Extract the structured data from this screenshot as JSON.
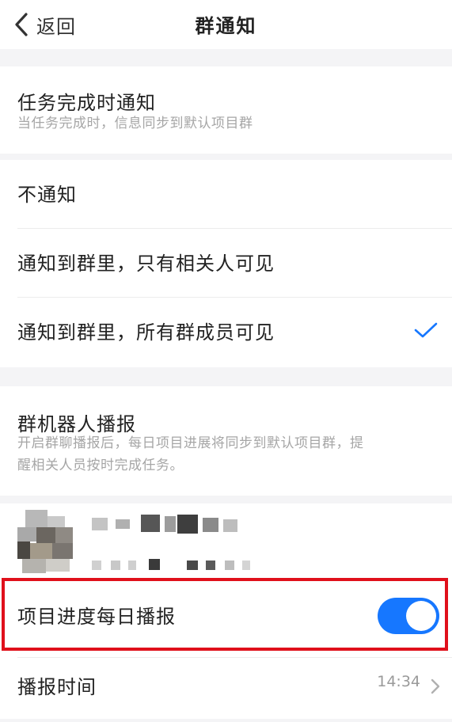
{
  "nav": {
    "back_label": "返回",
    "title": "群通知"
  },
  "task_notify": {
    "title": "任务完成时通知",
    "description": "当任务完成时，信息同步到默认项目群"
  },
  "notify_options": [
    {
      "label": "不通知",
      "selected": false
    },
    {
      "label": "通知到群里，只有相关人可见",
      "selected": false
    },
    {
      "label": "通知到群里，所有群成员可见",
      "selected": true
    }
  ],
  "robot": {
    "title": "群机器人播报",
    "description_line1": "开启群聊播报后，每日项目进展将同步到默认项目群，提",
    "description_line2": "醒相关人员按时完成任务。"
  },
  "daily_broadcast": {
    "label": "项目进度每日播报",
    "enabled": true
  },
  "broadcast_time": {
    "label": "播报时间",
    "value": "14:34"
  },
  "colors": {
    "accent": "#1677ff",
    "highlight_border": "#e0101b",
    "page_bg": "#f4f4f6",
    "muted_text": "#a6a6a6"
  },
  "icons": {
    "back": "chevron-left-icon",
    "selected": "checkmark-icon",
    "arrow": "chevron-right-icon"
  }
}
